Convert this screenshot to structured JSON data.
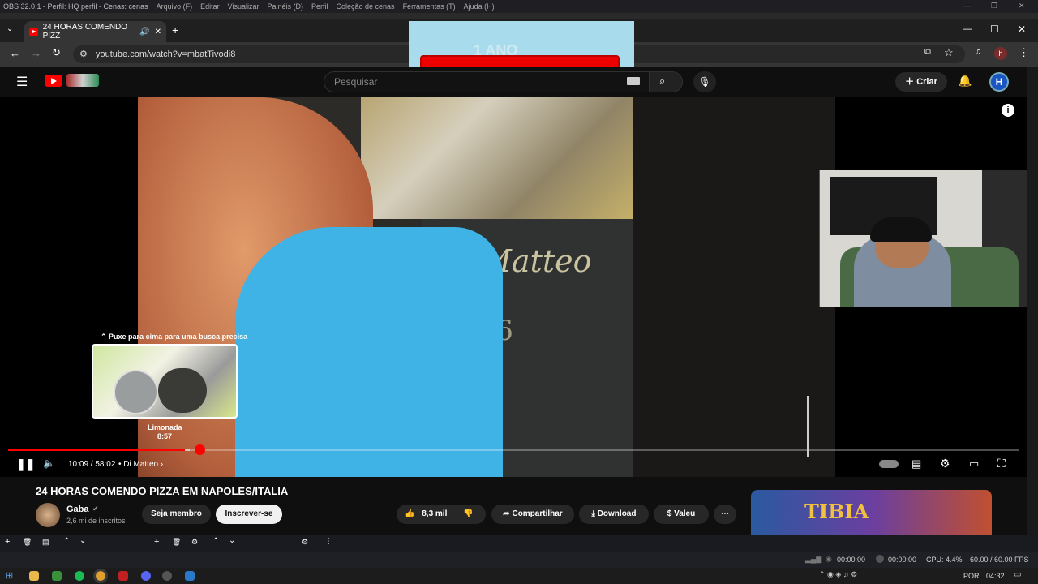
{
  "obs": {
    "title": "OBS 32.0.1 - Perfil: HQ perfil - Cenas: cenas",
    "menu": [
      "Arquivo (F)",
      "Editar",
      "Visualizar",
      "Painéis (D)",
      "Perfil",
      "Coleção de cenas",
      "Ferramentas (T)",
      "Ajuda (H)"
    ],
    "status": {
      "rec_time_1": "00:00:00",
      "rec_time_2": "00:00:00",
      "cpu": "CPU: 4.4%",
      "fps": "60.00 / 60.00 FPS"
    }
  },
  "browser": {
    "tab_title": "24 HORAS COMENDO PIZZ",
    "url": "youtube.com/watch?v=mbatTivodi8",
    "profile_initial": "h"
  },
  "youtube": {
    "search_placeholder": "Pesquisar",
    "create_label": "Criar"
  },
  "overlay": {
    "banner_text": "1 ANO"
  },
  "video": {
    "preview_hint": "Puxe para cima para uma busca precisa",
    "preview_chapter": "Limonada",
    "preview_time": "8:57",
    "time_current": "10:09",
    "time_total": "58:02",
    "chapter": "Di Matteo",
    "progress": 0.175,
    "buffered": 0.18,
    "floor_text_1": "Matteo",
    "floor_text_2": "936"
  },
  "details": {
    "title": "24 HORAS COMENDO PIZZA EM NAPOLES/ITALIA",
    "channel_name": "Gaba",
    "subscribers": "2,6 mi de inscritos",
    "member_label": "Seja membro",
    "subscribe_label": "Inscrever-se",
    "likes": "8,3 mil",
    "share_label": "Compartilhar",
    "download_label": "Download",
    "thanks_label": "Valeu",
    "ad_text": "TIBIA"
  },
  "taskbar": {
    "lang": "POR",
    "clock": "04:32"
  },
  "colors": {
    "accent": "#ff0000",
    "subscribe_bg": "#f1f1f1",
    "obs_bg": "#1f2025"
  }
}
